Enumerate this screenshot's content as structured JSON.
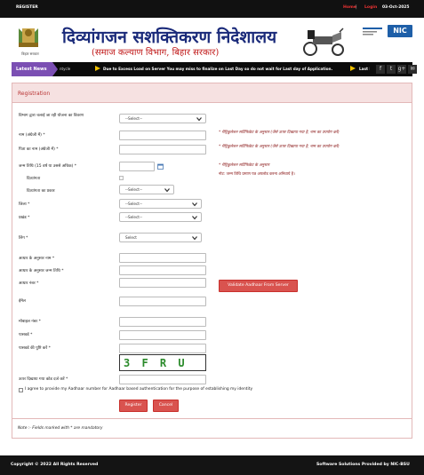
{
  "topbar": {
    "register": "REGISTER",
    "home": "Home",
    "sep": "|",
    "login": "Login",
    "date": "03-Oct-2025"
  },
  "header": {
    "title": "दिव्यांगजन सशक्तिकरण निदेशालय",
    "subtitle": "(समाज कल्याण विभाग, बिहार सरकार)",
    "emblem_caption": "बिहार सरकार",
    "nic": "NIC",
    "colors": {
      "title": "#1a2a7a",
      "subtitle": "#c01818"
    }
  },
  "news": {
    "label": "Latest News",
    "prefix": "ntycle",
    "text": "Due to Excess Load on Server You may miss to finalize on Last Day so do not wait for Last day of Application.",
    "text2": "Last Da",
    "social": [
      "f",
      "t",
      "g+",
      "✉"
    ]
  },
  "form": {
    "title": "Registration",
    "fields": {
      "scheme": {
        "label": "विभाग द्वारा चलाई जा रही योजना का विवरण",
        "value": "--Select--"
      },
      "name_en": {
        "label": "नाम (अंग्रेजी में) *"
      },
      "father_en": {
        "label": "पिता का नाम (अंग्रेजी में) *"
      },
      "dob": {
        "label": "जन्म तिथि (15 वर्ष या उससे अधिक) *"
      },
      "disability": {
        "label": "दिव्यांगता"
      },
      "disability_type": {
        "label": "दिव्यांगता का प्रकार",
        "value": "--Select--"
      },
      "district": {
        "label": "जिला *",
        "value": "--Select--"
      },
      "block": {
        "label": "प्रखंड *",
        "value": "--Select--"
      },
      "gender": {
        "label": "लिंग *",
        "value": "Select"
      },
      "aadhaar_name": {
        "label": "आधार के अनुसार नाम *"
      },
      "aadhaar_dob": {
        "label": "आधार के अनुसार जन्म तिथि *"
      },
      "aadhaar_no": {
        "label": "आधार नंबर *"
      },
      "email": {
        "label": "ईमेल"
      },
      "mobile": {
        "label": "मोबाइल नंबर *"
      },
      "password": {
        "label": "पासवर्ड *"
      },
      "confirm_password": {
        "label": "पासवर्ड की पुष्टि करें *"
      },
      "captcha_input": {
        "label": "ऊपर दिखाया गया कोड दर्ज करें *"
      }
    },
    "hints": {
      "h1": "* मैट्रिकुलेशन सर्टिफिकेट के अनुसार (जैसे ऊपर दिखाया गया है, नाम का उपयोग करें)",
      "h2": "* मैट्रिकुलेशन सर्टिफिकेट के अनुसार (जैसे ऊपर दिखाया गया है, नाम का उपयोग करें)",
      "h3": "* मैट्रिकुलेशन सर्टिफिकेट के अनुसार",
      "h4": "नोट: जन्म तिथि प्रमाण पत्र अपलोड करना अनिवार्य है।"
    },
    "captcha": "3 F R U",
    "validate_button": "Validate Aadhaar From Server",
    "consent": "I agree to provide my Aadhaar number for Aadhaar based authentication for the purpose of establishing my identity",
    "register_button": "Register",
    "cancel_button": "Cancel",
    "note": "Note :- Fields marked with * are mandatory"
  },
  "footer": {
    "copyright": "Copyright © 2022 All Rights Reserved",
    "provider": "Software Solutions Provided by NIC-BSU"
  }
}
